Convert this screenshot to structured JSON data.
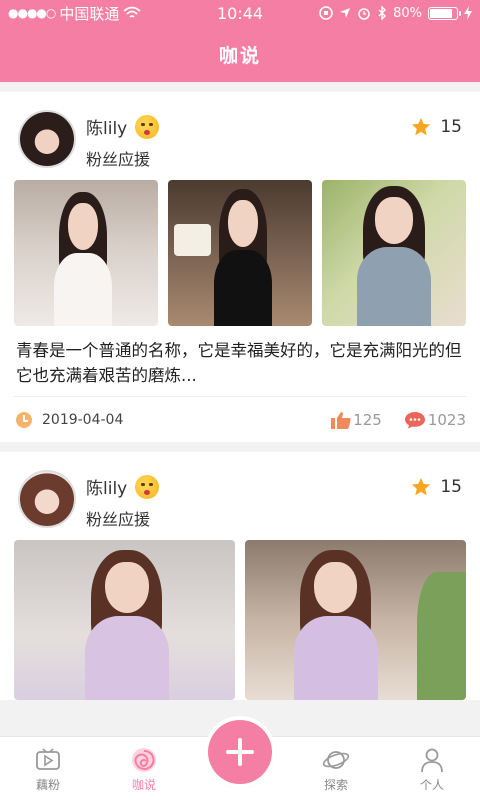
{
  "status_bar": {
    "carrier": "中国联通",
    "time": "10:44",
    "battery": "80%"
  },
  "nav": {
    "title": "咖说"
  },
  "posts": [
    {
      "username": "陈lily",
      "subtitle": "粉丝应援",
      "star_count": "15",
      "text": "青春是一个普通的名称，它是幸福美好的，它是充满阳光的但它也充满着艰苦的磨炼...",
      "date": "2019-04-04",
      "likes": "125",
      "comments": "1023"
    },
    {
      "username": "陈lily",
      "subtitle": "粉丝应援",
      "star_count": "15"
    }
  ],
  "tabs": [
    {
      "label": "藕粉",
      "icon": "play-icon"
    },
    {
      "label": "咖说",
      "icon": "swirl-icon"
    },
    {
      "label": "探索",
      "icon": "planet-icon"
    },
    {
      "label": "个人",
      "icon": "person-icon"
    }
  ],
  "colors": {
    "accent": "#f57fa4",
    "star": "#f5a623",
    "like": "#f08a5d",
    "comment": "#e9675a"
  }
}
